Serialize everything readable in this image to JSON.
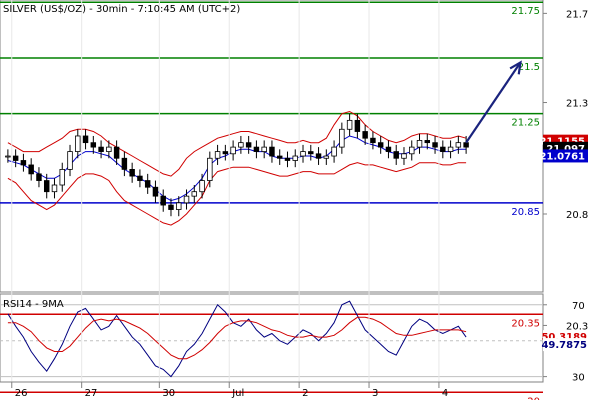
{
  "chart_data": [
    {
      "panel": "price",
      "type": "candlestick",
      "title": "SILVER (US$/OZ) - 30min - 7:10:45 AM (UTC+2)",
      "ylim": [
        20.45,
        21.76
      ],
      "yticks": [
        "21.7",
        "21.3",
        "20.8",
        "20.3"
      ],
      "xticks": [
        "26",
        "27",
        "30",
        "Jul",
        "2",
        "3",
        "4"
      ],
      "levels": [
        {
          "label": "21.75",
          "value": 21.75,
          "color": "#008000"
        },
        {
          "label": "21.5",
          "value": 21.5,
          "color": "#008000"
        },
        {
          "label": "21.25",
          "value": 21.25,
          "color": "#008000"
        },
        {
          "label": "20.85",
          "value": 20.85,
          "color": "#0000cc"
        },
        {
          "label": "20.35",
          "value": 20.35,
          "color": "#d00000"
        },
        {
          "label": "20",
          "value": 20.0,
          "color": "#d00000"
        }
      ],
      "price_tags": [
        {
          "label": "21.1155",
          "value": 21.1155,
          "color": "#d00000"
        },
        {
          "label": "21.097",
          "value": 21.097,
          "color": "#000000"
        },
        {
          "label": "21.0761",
          "value": 21.0761,
          "color": "#0000cc"
        }
      ],
      "price_path": [
        [
          0,
          21.06
        ],
        [
          1,
          21.04
        ],
        [
          2,
          21.02
        ],
        [
          3,
          20.98
        ],
        [
          4,
          20.95
        ],
        [
          5,
          20.9
        ],
        [
          6,
          20.93
        ],
        [
          7,
          21.0
        ],
        [
          8,
          21.08
        ],
        [
          9,
          21.15
        ],
        [
          10,
          21.12
        ],
        [
          11,
          21.1
        ],
        [
          12,
          21.08
        ],
        [
          13,
          21.1
        ],
        [
          14,
          21.05
        ],
        [
          15,
          21.0
        ],
        [
          16,
          20.97
        ],
        [
          17,
          20.95
        ],
        [
          18,
          20.92
        ],
        [
          19,
          20.88
        ],
        [
          20,
          20.84
        ],
        [
          21,
          20.82
        ],
        [
          22,
          20.85
        ],
        [
          23,
          20.88
        ],
        [
          24,
          20.9
        ],
        [
          25,
          20.95
        ],
        [
          26,
          21.05
        ],
        [
          27,
          21.08
        ],
        [
          28,
          21.07
        ],
        [
          29,
          21.1
        ],
        [
          30,
          21.12
        ],
        [
          31,
          21.1
        ],
        [
          32,
          21.08
        ],
        [
          33,
          21.1
        ],
        [
          34,
          21.06
        ],
        [
          35,
          21.05
        ],
        [
          36,
          21.04
        ],
        [
          37,
          21.06
        ],
        [
          38,
          21.08
        ],
        [
          39,
          21.07
        ],
        [
          40,
          21.05
        ],
        [
          41,
          21.06
        ],
        [
          42,
          21.1
        ],
        [
          43,
          21.18
        ],
        [
          44,
          21.22
        ],
        [
          45,
          21.17
        ],
        [
          46,
          21.14
        ],
        [
          47,
          21.12
        ],
        [
          48,
          21.1
        ],
        [
          49,
          21.08
        ],
        [
          50,
          21.05
        ],
        [
          51,
          21.07
        ],
        [
          52,
          21.1
        ],
        [
          53,
          21.13
        ],
        [
          54,
          21.12
        ],
        [
          55,
          21.1
        ],
        [
          56,
          21.08
        ],
        [
          57,
          21.1
        ],
        [
          58,
          21.12
        ],
        [
          59,
          21.1
        ]
      ],
      "bollinger_upper": [
        21.12,
        21.1,
        21.08,
        21.08,
        21.08,
        21.1,
        21.12,
        21.14,
        21.17,
        21.18,
        21.18,
        21.17,
        21.15,
        21.12,
        21.1,
        21.08,
        21.06,
        21.04,
        21.02,
        21.0,
        20.98,
        20.97,
        21.0,
        21.05,
        21.08,
        21.1,
        21.12,
        21.14,
        21.15,
        21.16,
        21.17,
        21.17,
        21.16,
        21.15,
        21.14,
        21.13,
        21.12,
        21.12,
        21.13,
        21.12,
        21.12,
        21.14,
        21.2,
        21.25,
        21.26,
        21.24,
        21.2,
        21.17,
        21.15,
        21.13,
        21.12,
        21.13,
        21.15,
        21.16,
        21.16,
        21.15,
        21.14,
        21.14,
        21.15,
        21.14
      ],
      "bollinger_lower": [
        20.96,
        20.94,
        20.9,
        20.86,
        20.84,
        20.82,
        20.84,
        20.88,
        20.92,
        20.96,
        20.98,
        20.98,
        20.97,
        20.95,
        20.9,
        20.86,
        20.84,
        20.82,
        20.8,
        20.78,
        20.76,
        20.75,
        20.77,
        20.8,
        20.84,
        20.88,
        20.95,
        20.99,
        21.0,
        21.01,
        21.01,
        21.01,
        21.0,
        20.99,
        20.98,
        20.97,
        20.97,
        20.98,
        20.99,
        20.99,
        20.98,
        20.98,
        20.98,
        21.0,
        21.02,
        21.03,
        21.02,
        21.02,
        21.01,
        21.0,
        20.99,
        21.0,
        21.01,
        21.03,
        21.03,
        21.03,
        21.02,
        21.02,
        21.03,
        21.03
      ],
      "moving_average": [
        21.04,
        21.03,
        21.02,
        21.0,
        20.98,
        20.96,
        20.96,
        20.98,
        21.02,
        21.06,
        21.08,
        21.08,
        21.07,
        21.06,
        21.03,
        21.0,
        20.98,
        20.96,
        20.94,
        20.91,
        20.88,
        20.86,
        20.87,
        20.89,
        20.92,
        20.96,
        21.02,
        21.05,
        21.06,
        21.08,
        21.09,
        21.09,
        21.08,
        21.08,
        21.06,
        21.05,
        21.05,
        21.05,
        21.06,
        21.06,
        21.05,
        21.06,
        21.09,
        21.13,
        21.15,
        21.14,
        21.12,
        21.11,
        21.1,
        21.08,
        21.07,
        21.07,
        21.08,
        21.1,
        21.1,
        21.09,
        21.08,
        21.08,
        21.09,
        21.09
      ],
      "projection_arrow": {
        "from": [
          59,
          21.12
        ],
        "to": [
          66,
          21.48
        ],
        "color": "#1a237e"
      }
    },
    {
      "panel": "rsi",
      "type": "line",
      "title": "RSI14 - 9MA",
      "ylim": [
        27,
        76
      ],
      "yticks": [
        "70",
        "50",
        "30"
      ],
      "hlines": [
        70,
        50,
        30
      ],
      "value_tags": [
        {
          "label": "50.3189",
          "value": 50.3189,
          "color": "#d00000"
        },
        {
          "label": "49.7875",
          "value": 49.7875,
          "color": "#000080"
        }
      ],
      "series": [
        {
          "color": "#000080",
          "values": [
            65,
            58,
            52,
            44,
            38,
            33,
            40,
            48,
            58,
            66,
            68,
            62,
            56,
            58,
            64,
            58,
            52,
            48,
            42,
            36,
            34,
            30,
            36,
            44,
            48,
            54,
            62,
            70,
            66,
            60,
            58,
            62,
            56,
            52,
            54,
            50,
            48,
            52,
            56,
            54,
            50,
            54,
            60,
            70,
            72,
            64,
            56,
            52,
            48,
            44,
            42,
            50,
            58,
            62,
            60,
            56,
            54,
            56,
            58,
            52
          ]
        },
        {
          "color": "#d00000",
          "values": [
            60,
            60,
            58,
            55,
            50,
            46,
            44,
            44,
            47,
            52,
            57,
            61,
            62,
            61,
            62,
            61,
            59,
            57,
            54,
            50,
            46,
            42,
            40,
            40,
            42,
            45,
            49,
            54,
            58,
            60,
            61,
            61,
            60,
            58,
            56,
            55,
            53,
            52,
            52,
            53,
            52,
            52,
            53,
            56,
            60,
            63,
            63,
            62,
            60,
            57,
            54,
            53,
            53,
            54,
            55,
            56,
            56,
            56,
            56,
            55
          ]
        }
      ]
    }
  ]
}
